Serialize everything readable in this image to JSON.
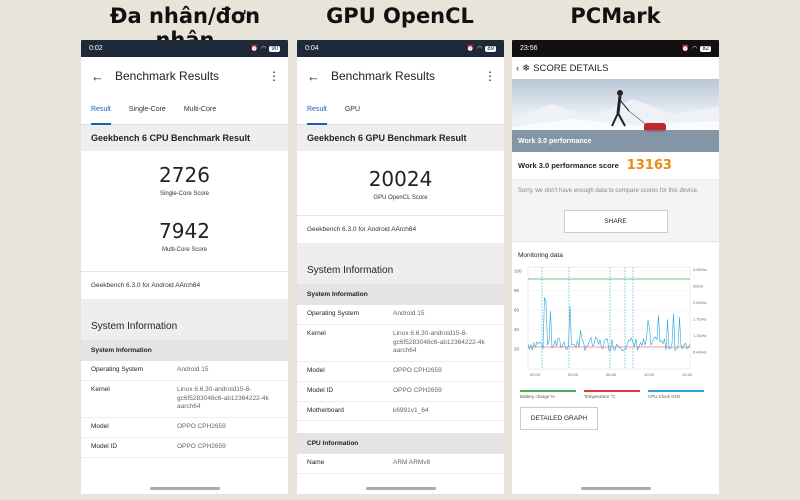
{
  "column_titles": [
    "Đa nhân/đơn nhân",
    "GPU OpenCL",
    "PCMark"
  ],
  "phone1": {
    "time": "0:02",
    "battery": "90",
    "title": "Benchmark Results",
    "tabs": [
      "Result",
      "Single-Core",
      "Multi-Core"
    ],
    "result_header": "Geekbench 6 CPU Benchmark Result",
    "single_score": "2726",
    "single_label": "Single-Core Score",
    "multi_score": "7942",
    "multi_label": "Multi-Core Score",
    "version": "Geekbench 6.3.0 for Android AArch64",
    "section": "System Information",
    "subheader": "System Information",
    "rows": [
      {
        "k": "Operating System",
        "v": "Android 15"
      },
      {
        "k": "Kernel",
        "v": "Linux 6.6.30-android15-8-gc6f5283046c6-ab12364222-4k aarch64"
      },
      {
        "k": "Model",
        "v": "OPPO CPH2659"
      },
      {
        "k": "Model ID",
        "v": "OPPO CPH2659"
      }
    ]
  },
  "phone2": {
    "time": "0:04",
    "battery": "89",
    "title": "Benchmark Results",
    "tabs": [
      "Result",
      "GPU"
    ],
    "result_header": "Geekbench 6 GPU Benchmark Result",
    "score": "20024",
    "score_label": "GPU OpenCL Score",
    "version": "Geekbench 6.3.0 for Android AArch64",
    "section": "System Information",
    "subheader": "System Information",
    "rows": [
      {
        "k": "Operating System",
        "v": "Android 15"
      },
      {
        "k": "Kernel",
        "v": "Linux 6.6.30-android15-8-gc6f5283046c6-ab12364222-4k aarch64"
      },
      {
        "k": "Model",
        "v": "OPPO CPH2659"
      },
      {
        "k": "Model ID",
        "v": "OPPO CPH2659"
      },
      {
        "k": "Motherboard",
        "v": "k6991v1_64"
      }
    ],
    "cpu_header": "CPU Information",
    "cpu_row": {
      "k": "Name",
      "v": "ARM ARMv8"
    }
  },
  "phone3": {
    "time": "23:56",
    "battery": "82",
    "title": "SCORE DETAILS",
    "banner": "Work 3.0 performance",
    "score_label": "Work 3.0 performance score",
    "score": "13163",
    "note": "Sorry, we don't have enough data to compare scores for this device.",
    "share": "SHARE",
    "monitoring": "Monitoring data",
    "chart_left_ticks": [
      "100",
      "80",
      "60",
      "40",
      "20"
    ],
    "chart_right_ticks": [
      "3.4GHz",
      "3GHz",
      "2.6GHz",
      "1.7GHz",
      "1.3GHz",
      "0.4GHz"
    ],
    "chart_x_ticks": [
      "00:00",
      "03:40",
      "06:40",
      "10:00",
      "13:40"
    ],
    "legend": [
      {
        "label": "Battery charge %",
        "color": "#4caf50"
      },
      {
        "label": "Temperature °C",
        "color": "#e53935"
      },
      {
        "label": "CPU Clock GHz",
        "color": "#2aa6d8"
      }
    ],
    "detailed": "DETAILED GRAPH"
  }
}
